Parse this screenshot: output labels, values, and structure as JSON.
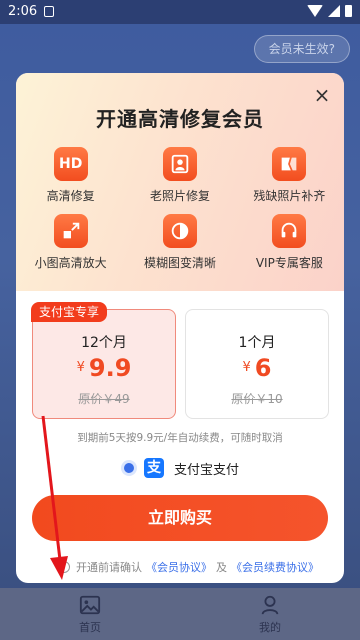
{
  "status_bar": {
    "time": "2:06"
  },
  "backdrop": {
    "member_pill": "会员未生效?"
  },
  "dialog": {
    "title": "开通高清修复会员",
    "features": [
      {
        "icon": "hd-icon",
        "glyph": "HD",
        "label": "高清修复"
      },
      {
        "icon": "portrait-photo-icon",
        "glyph": "",
        "label": "老照片修复"
      },
      {
        "icon": "broken-photo-icon",
        "glyph": "",
        "label": "残缺照片补齐"
      },
      {
        "icon": "expand-icon",
        "glyph": "",
        "label": "小图高清放大"
      },
      {
        "icon": "blur-to-clear-icon",
        "glyph": "",
        "label": "模糊图变清晰"
      },
      {
        "icon": "headset-icon",
        "glyph": "",
        "label": "VIP专属客服"
      }
    ],
    "plans": [
      {
        "badge": "支付宝专享",
        "duration": "12个月",
        "currency": "¥",
        "price": "9.9",
        "original": "原价￥49",
        "selected": true
      },
      {
        "duration": "1个月",
        "currency": "¥",
        "price": "6",
        "original": "原价￥10",
        "selected": false
      }
    ],
    "renew_note": "到期前5天按9.9元/年自动续费，可随时取消",
    "payment_method": "支付宝支付",
    "alipay_glyph": "支",
    "buy_label": "立即购买",
    "agreement": {
      "prefix": "开通前请确认",
      "link1": "《会员协议》",
      "and": "及",
      "link2": "《会员续费协议》"
    }
  },
  "bottom_nav": {
    "home": "首页",
    "mine": "我的"
  },
  "colors": {
    "accent": "#f24a1e",
    "link": "#3a6fe8",
    "alipay": "#1677ff"
  }
}
